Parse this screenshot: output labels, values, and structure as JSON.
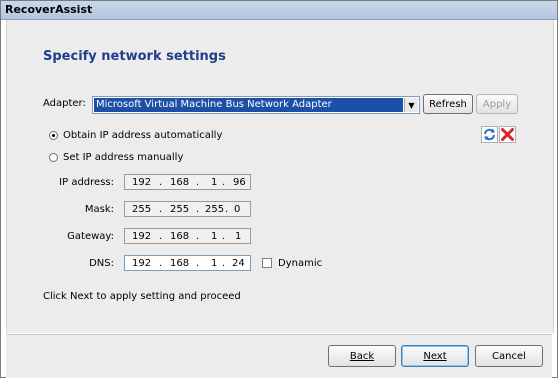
{
  "window": {
    "title": "RecoverAssist"
  },
  "page": {
    "heading": "Specify network settings"
  },
  "adapter": {
    "label": "Adapter:",
    "selected": "Microsoft Virtual Machine Bus Network Adapter",
    "refresh_label": "Refresh",
    "apply_label": "Apply"
  },
  "options": {
    "auto_label": "Obtain IP address automatically",
    "manual_label": "Set IP address manually",
    "selected": "auto"
  },
  "fields": {
    "ip": {
      "label": "IP address:",
      "octets": [
        "192",
        "168",
        "1",
        "96"
      ]
    },
    "mask": {
      "label": "Mask:",
      "octets": [
        "255",
        "255",
        "255",
        "0"
      ]
    },
    "gateway": {
      "label": "Gateway:",
      "octets": [
        "192",
        "168",
        "1",
        "1"
      ]
    },
    "dns": {
      "label": "DNS:",
      "octets": [
        "192",
        "168",
        "1",
        "24"
      ]
    },
    "dynamic_label": "Dynamic",
    "dynamic_checked": false
  },
  "hint": "Click Next to apply setting and proceed",
  "nav": {
    "back": "Back",
    "next": "Next",
    "cancel": "Cancel"
  },
  "icons": {
    "refresh": "refresh-arrows-icon",
    "delete": "red-x-icon"
  },
  "colors": {
    "heading": "#1f3f8c",
    "selection": "#1e4fa8",
    "delete": "#d8232a",
    "refresh": "#2a6fd0"
  }
}
